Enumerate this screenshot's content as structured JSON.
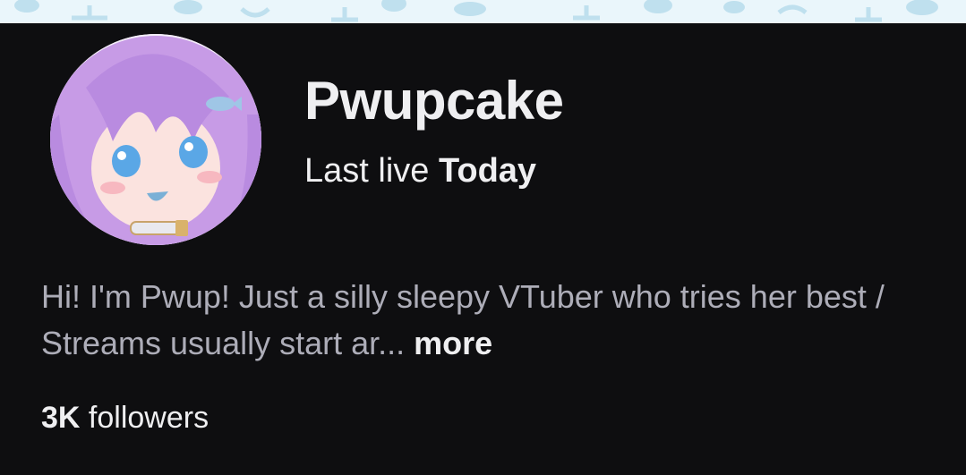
{
  "profile": {
    "display_name": "Pwupcake",
    "last_live_label": "Last live",
    "last_live_value": "Today",
    "bio_text": "Hi! I'm Pwup! Just a silly sleepy VTuber who tries her best / Streams usually start ar...",
    "more_label": "more",
    "followers_count": "3K",
    "followers_label": "followers"
  },
  "colors": {
    "background": "#0e0e10",
    "primary_text": "#efeff1",
    "secondary_text": "#adadb8",
    "banner": "#eaf6fb"
  },
  "icons": {
    "avatar": "vtuber-avatar-illustration"
  }
}
